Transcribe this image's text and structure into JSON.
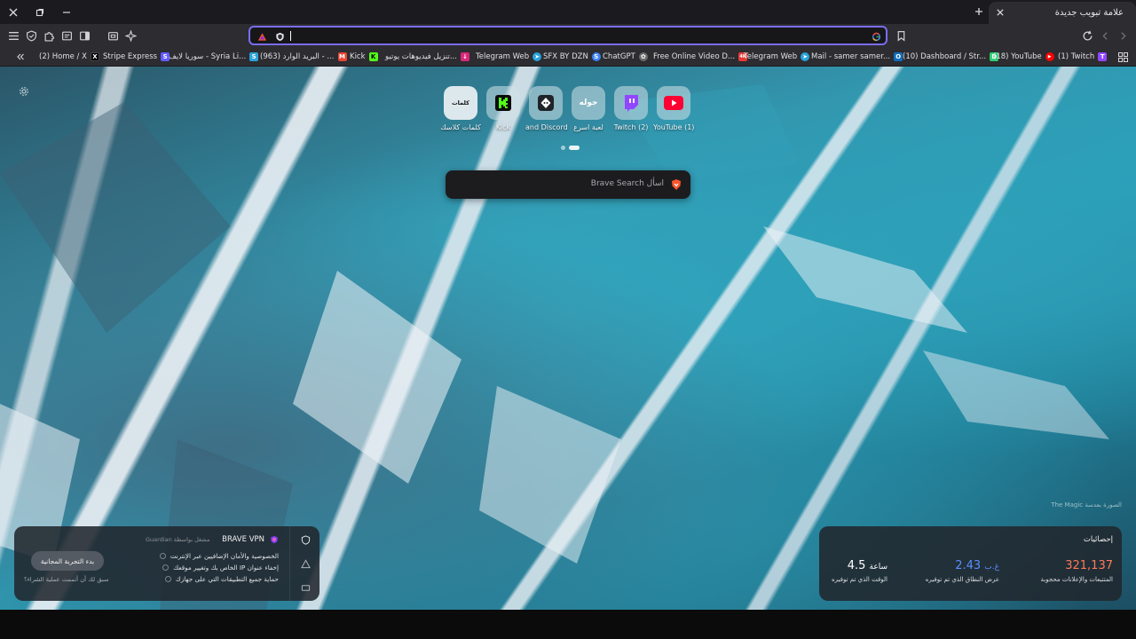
{
  "window": {
    "close_icon": "close-icon",
    "restore_icon": "restore-icon",
    "minimize_icon": "minimize-icon"
  },
  "tabs": [
    {
      "title": "علامة تبويب جديدة",
      "active": true
    }
  ],
  "omnibox": {
    "value": "",
    "left_icons": [
      "brave-rewards-icon",
      "brave-shields-icon"
    ],
    "right_icon": "google-icon"
  },
  "bookmarks": [
    {
      "label": "(2) Home / X",
      "icon": "x-icon",
      "color": "#000000",
      "glyph": "X"
    },
    {
      "label": "Stripe Express",
      "icon": "stripe-icon",
      "color": "#635bff",
      "glyph": "S"
    },
    {
      "label": "سوريا لايف - Syria Li...",
      "icon": "syria-live-icon",
      "color": "#2aa3d8",
      "glyph": "S"
    },
    {
      "label": "البريد الوارد (963) - ...",
      "icon": "gmail-icon",
      "color": "#ea4335",
      "glyph": "M"
    },
    {
      "label": "Kick",
      "icon": "kick-icon",
      "color": "#53fc18",
      "glyph": "K"
    },
    {
      "label": "تنزيل فيديوهات يوتيو...",
      "icon": "download-icon",
      "color": "#d6287a",
      "glyph": "↓"
    },
    {
      "label": "Telegram Web",
      "icon": "telegram-icon",
      "color": "#2aa1da",
      "glyph": "➤"
    },
    {
      "label": "SFX BY DZN",
      "icon": "sfx-icon",
      "color": "#3b82f6",
      "glyph": "S"
    },
    {
      "label": "ChatGPT",
      "icon": "chatgpt-icon",
      "color": "#6b6b6b",
      "glyph": "✿"
    },
    {
      "label": "Free Online Video D...",
      "icon": "video-icon",
      "color": "#e53935",
      "glyph": "4K"
    },
    {
      "label": "Telegram Web",
      "icon": "telegram-icon",
      "color": "#2aa1da",
      "glyph": "➤"
    },
    {
      "label": "Mail - samer samer...",
      "icon": "outlook-icon",
      "color": "#0f6cbd",
      "glyph": "O"
    },
    {
      "label": "(10) Dashboard / Str...",
      "icon": "dashboard-icon",
      "color": "#2ecc71",
      "glyph": "D"
    },
    {
      "label": "(18) YouTube",
      "icon": "youtube-icon",
      "color": "#ff0000",
      "glyph": "▶"
    },
    {
      "label": "(1) Twitch",
      "icon": "twitch-icon",
      "color": "#9146ff",
      "glyph": "T"
    }
  ],
  "top_sites": [
    {
      "label": "YouTube (1)",
      "icon": "youtube-icon",
      "bg": "#ff0033",
      "glyph": "▶"
    },
    {
      "label": "Twitch (2)",
      "icon": "twitch-icon",
      "bg": "#9146ff",
      "glyph": "T"
    },
    {
      "label": "لعبة اسرع",
      "icon": "game-icon",
      "bg": "#e8f0f4",
      "glyph": "جوله"
    },
    {
      "label": "and Discord",
      "icon": "discord-icon",
      "bg": "#1f2428",
      "glyph": "◆"
    },
    {
      "label": "Kick",
      "icon": "kick-icon",
      "bg": "#0b0b0b",
      "glyph": "K"
    },
    {
      "label": "كلمات كلاسك",
      "icon": "kalimat-icon",
      "bg": "#ffffff",
      "glyph": "كلمات"
    }
  ],
  "search": {
    "placeholder": "اسأل Brave Search"
  },
  "photo_credit": "الصورة بعدسة The Magic",
  "vpn": {
    "title": "BRAVE VPN",
    "powered_by": "مشغل بواسطة Guardian",
    "features": [
      "الخصوصية والأمان الإضافيين عبر الإنترنت",
      "إخفاء عنوان IP الخاص بك وتغيير موقعك",
      "حماية جميع التطبيقات التي على جهازك"
    ],
    "trial_button": "بدء التجربة المجانية",
    "already_purchased": "سبق لك أن أتممت عملية الشراء؟"
  },
  "stats": {
    "title": "إحصائيات",
    "items": [
      {
        "value": "321,137",
        "unit": "",
        "label": "المتتبعات والإعلانات محجوبة",
        "color": "#ff7a59"
      },
      {
        "value": "2.43",
        "unit": "غ.ب",
        "label": "عرض النطاق الذي تم توفيره",
        "color": "#5a8dff"
      },
      {
        "value": "4.5",
        "unit": "ساعة",
        "label": "الوقت الذي تم توفيره",
        "color": "#ffffff"
      }
    ]
  }
}
